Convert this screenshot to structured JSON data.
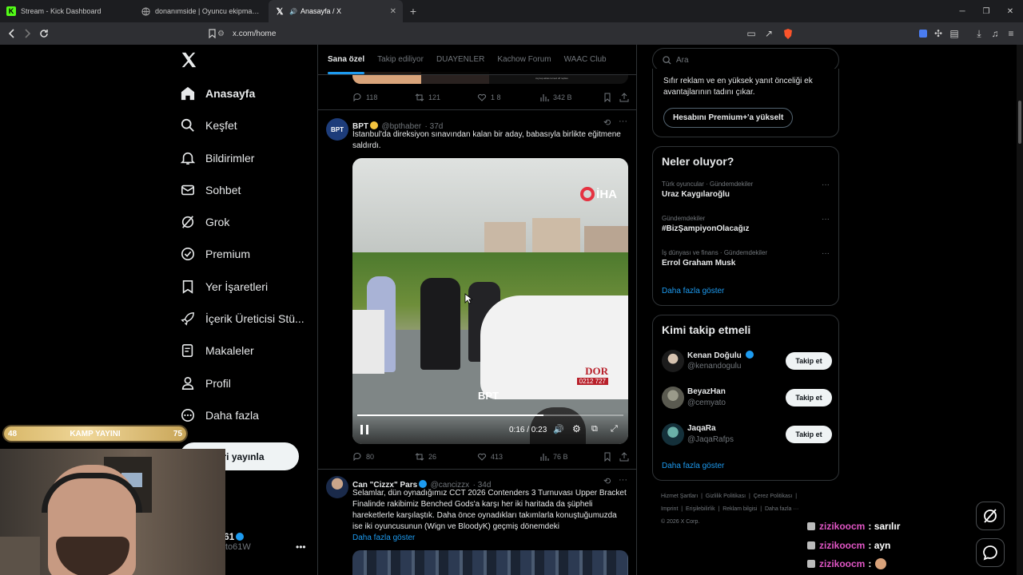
{
  "browser": {
    "tabs": [
      {
        "title": "Stream - Kick Dashboard",
        "icon": "kick-icon"
      },
      {
        "title": "donanımside | Oyuncu ekipman ince",
        "icon": "globe-icon"
      },
      {
        "title": "Anasayfa / X",
        "icon": "x-logo-icon"
      }
    ],
    "new_tab": "+",
    "url": "x.com/home"
  },
  "nav": {
    "items": [
      {
        "label": "Anasayfa",
        "icon": "home-icon"
      },
      {
        "label": "Keşfet",
        "icon": "search-icon"
      },
      {
        "label": "Bildirimler",
        "icon": "bell-icon"
      },
      {
        "label": "Sohbet",
        "icon": "mail-icon"
      },
      {
        "label": "Grok",
        "icon": "grok-icon"
      },
      {
        "label": "Premium",
        "icon": "verified-icon"
      },
      {
        "label": "Yer İşaretleri",
        "icon": "bookmark-icon"
      },
      {
        "label": "İçerik Üreticisi Stü...",
        "icon": "rocket-icon"
      },
      {
        "label": "Makaleler",
        "icon": "article-icon"
      },
      {
        "label": "Profil",
        "icon": "person-icon"
      },
      {
        "label": "Daha fazla",
        "icon": "more-circle-icon"
      }
    ],
    "post_button": "leri yayınla",
    "account_name": "61",
    "account_handle": "to61W"
  },
  "feed": {
    "tabs": [
      "Sana özel",
      "Takip ediliyor",
      "DUAYENLER",
      "Kachow Forum",
      "WAAC Club"
    ],
    "top_post_stats": {
      "replies": "118",
      "reposts": "121",
      "likes": "1 8",
      "views": "342 B"
    },
    "top_media_caption": "zeynep.aktas turned off replies",
    "post1": {
      "name": "BPT",
      "handle": "@bpthaber",
      "time": "· 37d",
      "avatar_text": "BPT",
      "text": "İstanbul'da direksiyon sınavından kalan bir aday, babasıyla birlikte eğitmene saldırdı.",
      "video": {
        "watermark": "İHA",
        "logo": "BPT",
        "plate": "0212 727",
        "time": "0:16 / 0:23",
        "progress": 0.7
      },
      "stats": {
        "replies": "80",
        "reposts": "26",
        "likes": "413",
        "views": "76 B"
      }
    },
    "post2": {
      "name": "Can \"Cizzx\" Pars",
      "handle": "@cancizzx",
      "time": "· 34d",
      "text": "Selamlar, dün oynadığımız CCT 2026 Contenders 3 Turnuvası Upper Bracket Finalinde rakibimiz Benched Gods'a karşı her iki haritada da şüpheli hareketlerle karşılaştık. Daha önce oynadıkları takımlarla konuştuğumuzda ise iki oyuncusunun (Wign ve BloodyK) geçmiş dönemdeki",
      "more": "Daha fazla göster"
    }
  },
  "right": {
    "search_placeholder": "Ara",
    "premium_text": "Sıfır reklam ve en yüksek yanıt önceliği ek avantajlarının tadını çıkar.",
    "premium_button": "Hesabını Premium+'a yükselt",
    "trends_title": "Neler oluyor?",
    "trends": [
      {
        "meta": "Türk oyuncular · Gündemdekiler",
        "name": "Uraz Kaygılaroğlu"
      },
      {
        "meta": "Gündemdekiler",
        "name": "#BizŞampiyonOlacağız"
      },
      {
        "meta": "İş dünyası ve finans · Gündemdekiler",
        "name": "Errol Graham Musk"
      }
    ],
    "trends_more": "Daha fazla göster",
    "who_title": "Kimi takip etmeli",
    "who": [
      {
        "name": "Kenan Doğulu",
        "handle": "@kenandogulu",
        "button": "Takip et",
        "verified": true
      },
      {
        "name": "BeyazHan",
        "handle": "@cemyato",
        "button": "Takip et",
        "verified": false
      },
      {
        "name": "JaqaRa",
        "handle": "@JaqaRafps",
        "button": "Takip et",
        "verified": false
      }
    ],
    "who_more": "Daha fazla göster",
    "footer": [
      "Hizmet Şartları",
      "Gizlilik Politikası",
      "Çerez Politikası",
      "Imprint",
      "Erişilebilirlik",
      "Reklam bilgisi",
      "Daha fazla ···",
      "© 2026 X Corp."
    ]
  },
  "overlay": {
    "bar_left": "48",
    "bar_title": "KAMP YAYINI",
    "bar_right": "75",
    "chat": [
      {
        "user": "zizikoocm",
        "msg": ": sarılır"
      },
      {
        "user": "zizikoocm",
        "msg": ": ayn"
      },
      {
        "user": "zizikoocm",
        "msg": ":"
      }
    ]
  },
  "colors": {
    "accent": "#1d9bf0",
    "background": "#000000",
    "border": "#2f3336",
    "muted": "#71767b",
    "chat_user": "#e056c5"
  }
}
